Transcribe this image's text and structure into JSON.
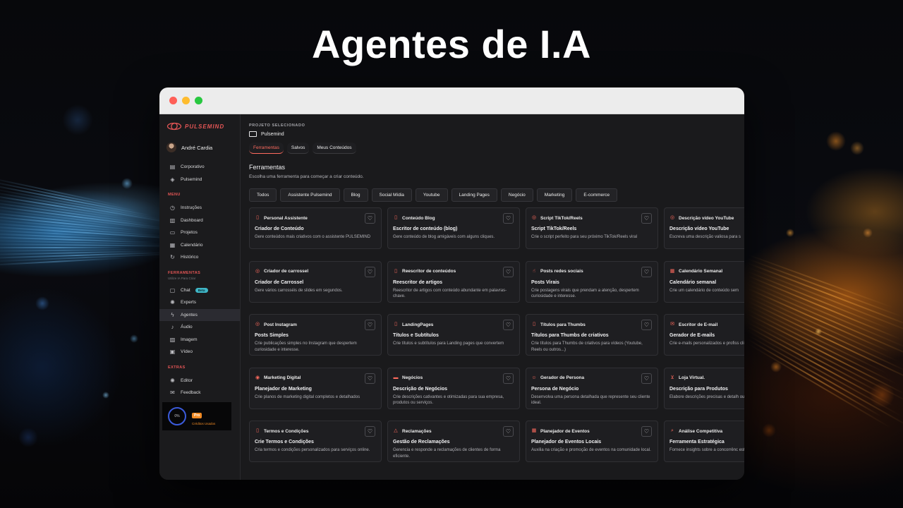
{
  "headline": "Agentes de I.A",
  "colors": {
    "accent": "#ff6b5e",
    "menu_section": "#e25555",
    "pro_badge": "#f08a24",
    "chat_badge": "#3fb6c6"
  },
  "sidebar": {
    "logo_text": "PULSEMIND",
    "user_name": "André Cardia",
    "workspaces": [
      {
        "label": "Corporativo",
        "icon": "building-icon"
      },
      {
        "label": "Pulsemind",
        "icon": "layers-icon"
      }
    ],
    "menu_title": "MENU",
    "menu_items": [
      {
        "label": "Instruções",
        "icon": "clock-icon"
      },
      {
        "label": "Dashboard",
        "icon": "bar-chart-icon"
      },
      {
        "label": "Projetos",
        "icon": "folder-icon"
      },
      {
        "label": "Calendário",
        "icon": "calendar-icon"
      },
      {
        "label": "Histórico",
        "icon": "history-icon"
      }
    ],
    "tools_title": "FERRAMENTAS",
    "tools_subtitle": "Utilize IA Para Criar",
    "tools_items": [
      {
        "label": "Chat",
        "icon": "chat-icon",
        "badge": "Beta"
      },
      {
        "label": "Experts",
        "icon": "gear-icon"
      },
      {
        "label": "Agentes",
        "icon": "lightning-icon",
        "active": true
      },
      {
        "label": "Áudio",
        "icon": "audio-icon"
      },
      {
        "label": "Imagem",
        "icon": "image-icon"
      },
      {
        "label": "Vídeo",
        "icon": "film-icon"
      }
    ],
    "extras_title": "EXTRAS",
    "extras_items": [
      {
        "label": "Editor",
        "icon": "gear-icon"
      },
      {
        "label": "Feedback",
        "icon": "feedback-icon"
      }
    ],
    "credits": {
      "percent": "0%",
      "plan": "Pro",
      "label": "Créditos Usados"
    }
  },
  "main": {
    "project_label": "PROJETO SELECIONADO",
    "project_name": "Pulsemind",
    "tabs": [
      "Ferramentas",
      "Salvos",
      "Meus Conteúdos"
    ],
    "section_title": "Ferramentas",
    "section_subtitle": "Escolha uma ferramenta para começar a criar conteúdo.",
    "filters": [
      "Todos",
      "Assistente Pulsemind",
      "Blog",
      "Social Mídia",
      "Youtube",
      "Landing Pages",
      "Negócio",
      "Marketing",
      "E-commerce"
    ],
    "cards": [
      {
        "label": "Personal Assistente",
        "icon": "document-icon",
        "title": "Criador de Conteúdo",
        "desc": "Gere conteúdos mais criativos com o assistente PULSEMIND"
      },
      {
        "label": "Conteúdo Blog",
        "icon": "document-icon",
        "title": "Escritor de conteúdo (blog)",
        "desc": "Gere conteúdo de blog amigáveis com alguns cliques."
      },
      {
        "label": "Script TikTok/Reels",
        "icon": "instagram-icon",
        "title": "Script TikTok/Reels",
        "desc": "Crie o script perfeito para seu próximo TikTok/Reels viral"
      },
      {
        "label": "Descrição vídeo YouTube",
        "icon": "instagram-icon",
        "title": "Descrição vídeo YouTube",
        "desc": "Escreva uma descrição valiosa para s"
      },
      {
        "label": "Criador de carrossel",
        "icon": "instagram-icon",
        "title": "Criador de Carrossel",
        "desc": "Gere vários carrosséis de slides em segundos."
      },
      {
        "label": "Reescritor de conteúdos",
        "icon": "document-icon",
        "title": "Reescritor de artigos",
        "desc": "Reescritor de artigos com conteúdo abundante em palavras-chave."
      },
      {
        "label": "Posts redes sociais",
        "icon": "thumbs-up-icon",
        "title": "Posts Virais",
        "desc": "Crie postagens virais que prendam a atenção, despertem curiosidade e interesse."
      },
      {
        "label": "Calendário Semanal",
        "icon": "calendar-icon",
        "title": "Calendário semanal",
        "desc": "Crie um calendário de conteúdo sem"
      },
      {
        "label": "Post Instagram",
        "icon": "instagram-icon",
        "title": "Posts Simples",
        "desc": "Crie publicações simples no Instagram que despertem curiosidade e interesse."
      },
      {
        "label": "LandingPages",
        "icon": "document-icon",
        "title": "Títulos e Subtítulos",
        "desc": "Crie títulos e subtítulos para Landing pages que convertem"
      },
      {
        "label": "Títulos para Thumbs",
        "icon": "document-icon",
        "title": "Títulos para Thumbs de criativos",
        "desc": "Crie títulos para Thumbs de criativos para vídeos (Youtube, Reels ou outros...)"
      },
      {
        "label": "Escritor de E-mail",
        "icon": "mail-icon",
        "title": "Gerador de E-mails",
        "desc": "Crie e-mails personalizados e profiss cliques"
      },
      {
        "label": "Marketing Digital",
        "icon": "target-icon",
        "title": "Planejador de Marketing",
        "desc": "Crie planos de marketing digital completos e detalhados"
      },
      {
        "label": "Negócios",
        "icon": "briefcase-icon",
        "title": "Descrição de Negócios",
        "desc": "Crie descrições cativantes e otimizadas para sua empresa, produtos ou serviços."
      },
      {
        "label": "Gerador de Persona",
        "icon": "user-icon",
        "title": "Persona de Negócio",
        "desc": "Desenvolva uma persona detalhada que represente seu cliente ideal."
      },
      {
        "label": "Loja Virtual.",
        "icon": "cart-icon",
        "title": "Descrição para Produtos",
        "desc": "Elabore descrições precisas e detalh ou serviços."
      },
      {
        "label": "Termos e Condições",
        "icon": "document-icon",
        "title": "Crie Termos e Condições",
        "desc": "Cria termos e condições personalizados para serviços online."
      },
      {
        "label": "Reclamações",
        "icon": "warning-icon",
        "title": "Gestão de Reclamações",
        "desc": "Gerencia e responde a reclamações de clientes de forma eficiente."
      },
      {
        "label": "Planejador de Eventos",
        "icon": "calendar-icon",
        "title": "Planejador de Eventos Locais",
        "desc": "Auxilia na criação e promoção de eventos na comunidade local."
      },
      {
        "label": "Análise Competitiva",
        "icon": "search-icon",
        "title": "Ferramenta Estratégica",
        "desc": "Fornece insights sobre a concorrênc estratégias de negócio."
      }
    ]
  }
}
